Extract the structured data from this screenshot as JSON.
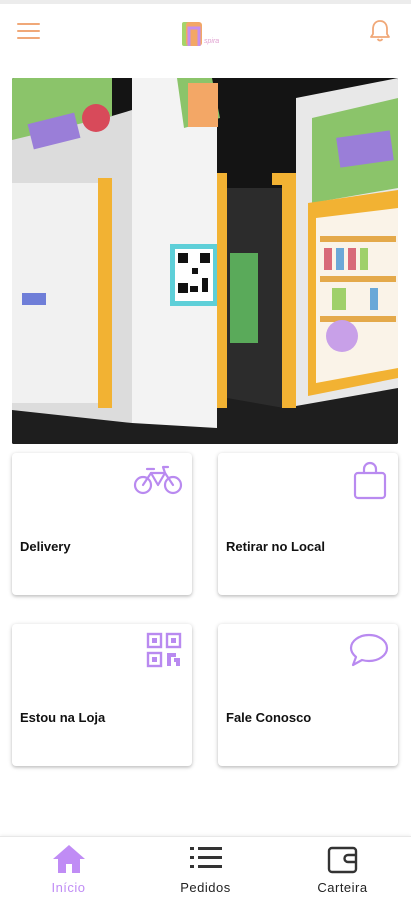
{
  "header": {
    "menu_icon": "hamburger-menu-icon",
    "logo_icon": "store-logo-icon",
    "logo_text": "spira",
    "notification_icon": "bell-icon",
    "accent_color": "#f0a878"
  },
  "hero": {
    "image": "storefront-photo",
    "qr_icon": "qr-code-icon"
  },
  "actions": [
    {
      "label": "Delivery",
      "icon": "bicycle-icon"
    },
    {
      "label": "Retirar no Local",
      "icon": "shopping-bag-icon"
    },
    {
      "label": "Estou na Loja",
      "icon": "qr-code-icon"
    },
    {
      "label": "Fale Conosco",
      "icon": "chat-bubble-icon"
    }
  ],
  "bottom_nav": {
    "items": [
      {
        "label": "Início",
        "icon": "home-icon",
        "active": true
      },
      {
        "label": "Pedidos",
        "icon": "list-icon",
        "active": false
      },
      {
        "label": "Carteira",
        "icon": "wallet-icon",
        "active": false
      }
    ],
    "active_color": "#c08cf5"
  },
  "colors": {
    "icon_purple": "#b98af0",
    "brand_orange": "#f0a878"
  }
}
